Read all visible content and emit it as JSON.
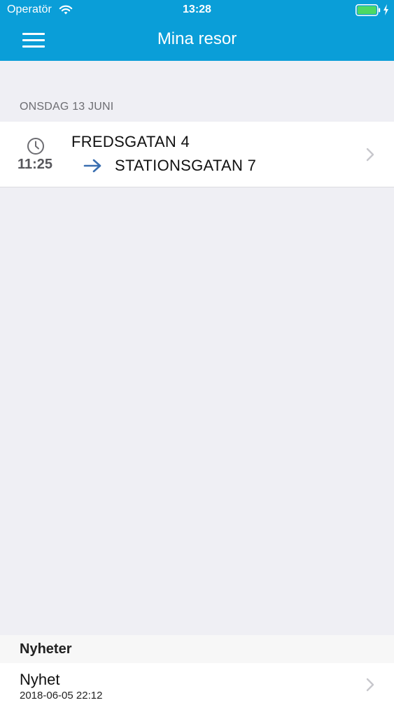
{
  "status_bar": {
    "carrier": "Operatör",
    "time": "13:28",
    "icons": [
      "wifi-icon",
      "battery-icon",
      "charging-bolt-icon"
    ],
    "battery_color": "#4cd964"
  },
  "navbar": {
    "title": "Mina resor",
    "menu_icon": "hamburger-menu-icon",
    "background_color": "#0a9ed8"
  },
  "trips": {
    "section_label": "ONSDAG 13 JUNI",
    "items": [
      {
        "time": "11:25",
        "from": "FREDSGATAN 4",
        "to": "STATIONSGATAN 7",
        "time_icon": "clock-icon",
        "direction_icon": "arrow-right-icon",
        "arrow_color": "#3a6fb0"
      }
    ]
  },
  "news": {
    "section_label": "Nyheter",
    "items": [
      {
        "title": "Nyhet",
        "date": "2018-06-05 22:12"
      }
    ]
  }
}
